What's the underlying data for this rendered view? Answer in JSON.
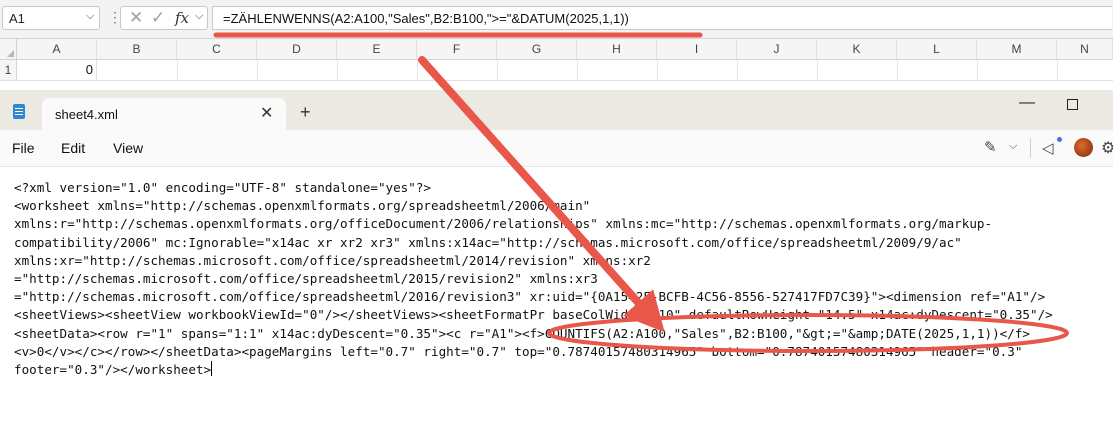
{
  "excel": {
    "name_box": "A1",
    "formula": "=ZÄHLENWENNS(A2:A100,\"Sales\",B2:B100,\">=\"&DATUM(2025,1,1))",
    "columns": [
      "A",
      "B",
      "C",
      "D",
      "E",
      "F",
      "G",
      "H",
      "I",
      "J",
      "K",
      "L",
      "M",
      "N"
    ],
    "row_number": "1",
    "cell_a1_value": "0"
  },
  "notepad": {
    "tab_title": "sheet4.xml",
    "menu": {
      "file": "File",
      "edit": "Edit",
      "view": "View"
    },
    "content": "<?xml version=\"1.0\" encoding=\"UTF-8\" standalone=\"yes\"?>\n<worksheet xmlns=\"http://schemas.openxmlformats.org/spreadsheetml/2006/main\"\nxmlns:r=\"http://schemas.openxmlformats.org/officeDocument/2006/relationships\" xmlns:mc=\"http://schemas.openxmlformats.org/markup-\ncompatibility/2006\" mc:Ignorable=\"x14ac xr xr2 xr3\" xmlns:x14ac=\"http://schemas.microsoft.com/office/spreadsheetml/2009/9/ac\"\nxmlns:xr=\"http://schemas.microsoft.com/office/spreadsheetml/2014/revision\" xmlns:xr2\n=\"http://schemas.microsoft.com/office/spreadsheetml/2015/revision2\" xmlns:xr3\n=\"http://schemas.microsoft.com/office/spreadsheetml/2016/revision3\" xr:uid=\"{0A1542F-BCFB-4C56-8556-527417FD7C39}\"><dimension ref=\"A1\"/>\n<sheetViews><sheetView workbookViewId=\"0\"/></sheetViews><sheetFormatPr baseColWidth=\"10\" defaultRowHeight=\"14.5\" x14ac:dyDescent=\"0.35\"/>\n<sheetData><row r=\"1\" spans=\"1:1\" x14ac:dyDescent=\"0.35\"><c r=\"A1\"><f>COUNTIFS(A2:A100,\"Sales\",B2:B100,\"&gt;=\"&amp;DATE(2025,1,1))</f>\n<v>0</v></c></row></sheetData><pageMargins left=\"0.7\" right=\"0.7\" top=\"0.78740157480314965\" bottom=\"0.78740157480314965\" header=\"0.3\"\nfooter=\"0.3\"/></worksheet>"
  },
  "colors": {
    "annotation": "#e8574a",
    "notepad_titlebar": "#ece8e2",
    "excel_formula_bar": "#f3f3f3"
  },
  "icons": [
    "chevron-down-icon",
    "cancel-icon",
    "enter-icon",
    "function-icon",
    "notepad-icon",
    "close-icon",
    "plus-icon",
    "minimize-icon",
    "maximize-icon",
    "copilot-icon",
    "feedback-icon",
    "profile-icon",
    "settings-icon"
  ]
}
